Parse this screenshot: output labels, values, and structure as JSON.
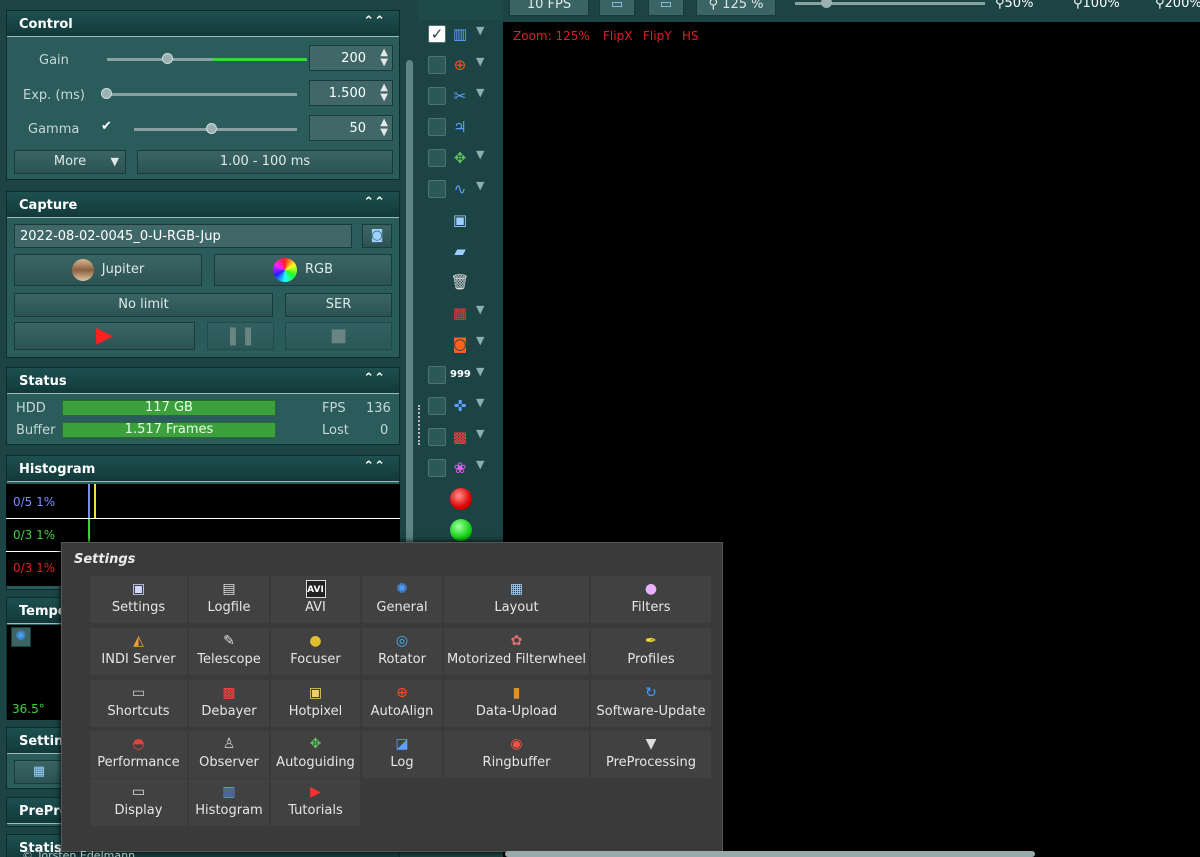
{
  "topbar": {
    "fps_button": "10 FPS",
    "zoom_button": "125 %",
    "zoom_presets": [
      "50%",
      "100%",
      "200%"
    ]
  },
  "control": {
    "title": "Control",
    "gain": {
      "label": "Gain",
      "value": "200",
      "slider_fraction": 0.3
    },
    "exposure": {
      "label": "Exp. (ms)",
      "value": "1.500",
      "slider_fraction": 0.0
    },
    "gamma": {
      "label": "Gamma",
      "value": "50",
      "checked": true,
      "slider_fraction": 0.5
    },
    "more_button": "More",
    "range_button": "1.00 - 100 ms"
  },
  "capture": {
    "title": "Capture",
    "filename": "2022-08-02-0045_0-U-RGB-Jup",
    "object_button": "Jupiter",
    "filter_button": "RGB",
    "limit_button": "No limit",
    "format_button": "SER"
  },
  "status": {
    "title": "Status",
    "hdd_label": "HDD",
    "hdd_value": "117 GB",
    "buffer_label": "Buffer",
    "buffer_value": "1.517 Frames",
    "fps_label": "FPS",
    "fps_value": "136",
    "lost_label": "Lost",
    "lost_value": "0"
  },
  "histogram": {
    "title": "Histogram",
    "rows": [
      {
        "label": "0/5 1%",
        "color": "#7a8cff"
      },
      {
        "label": "0/3 1%",
        "color": "#3cd23c"
      },
      {
        "label": "0/3 1%",
        "color": "#e02020"
      }
    ]
  },
  "hidden_panels": {
    "temperature": "Tempe",
    "temp_value": "36.5°",
    "settings": "Setting",
    "preprocessing": "PrePro",
    "statistics": "Statist"
  },
  "viewer": {
    "zoom_text": "Zoom: 125%",
    "flipx": "FlipX",
    "flipy": "FlipY",
    "hs": "HS"
  },
  "settings_popup": {
    "title": "Settings",
    "items": [
      {
        "label": "Settings",
        "icon": "settings-icon",
        "glyph": "▣",
        "color": "#cfd8ff"
      },
      {
        "label": "Logfile",
        "icon": "logfile-icon",
        "glyph": "▤",
        "color": "#dddddd"
      },
      {
        "label": "AVI",
        "icon": "avi-icon",
        "glyph": "AVI",
        "color": "#ffffff"
      },
      {
        "label": "General",
        "icon": "gear-icon",
        "glyph": "✺",
        "color": "#4a9aff"
      },
      {
        "label": "Layout",
        "icon": "layout-icon",
        "glyph": "▦",
        "color": "#9ad0ff"
      },
      {
        "label": "Filters",
        "icon": "color-wheel-icon",
        "glyph": "●",
        "color": "#e8b0ff"
      },
      {
        "label": "INDI Server",
        "icon": "indi-icon",
        "glyph": "◭",
        "color": "#f0a030"
      },
      {
        "label": "Telescope",
        "icon": "telescope-icon",
        "glyph": "✎",
        "color": "#dddddd"
      },
      {
        "label": "Focuser",
        "icon": "focuser-icon",
        "glyph": "●",
        "color": "#e0c030"
      },
      {
        "label": "Rotator",
        "icon": "rotator-icon",
        "glyph": "◎",
        "color": "#4ab0ff"
      },
      {
        "label": "Motorized Filterwheel",
        "icon": "filterwheel-icon",
        "glyph": "✿",
        "color": "#e07070"
      },
      {
        "label": "Profiles",
        "icon": "profiles-icon",
        "glyph": "✒",
        "color": "#f0e030"
      },
      {
        "label": "Shortcuts",
        "icon": "keyboard-icon",
        "glyph": "▭",
        "color": "#cccccc"
      },
      {
        "label": "Debayer",
        "icon": "debayer-icon",
        "glyph": "▩",
        "color": "#ff4040"
      },
      {
        "label": "Hotpixel",
        "icon": "hotpixel-icon",
        "glyph": "▣",
        "color": "#f0d060"
      },
      {
        "label": "AutoAlign",
        "icon": "crosshair-icon",
        "glyph": "⊕",
        "color": "#ff5020"
      },
      {
        "label": "Data-Upload",
        "icon": "upload-icon",
        "glyph": "▮",
        "color": "#e09030"
      },
      {
        "label": "Software-Update",
        "icon": "update-icon",
        "glyph": "↻",
        "color": "#40a0ff"
      },
      {
        "label": "Performance",
        "icon": "gauge-icon",
        "glyph": "◓",
        "color": "#e04040"
      },
      {
        "label": "Observer",
        "icon": "person-icon",
        "glyph": "♙",
        "color": "#cccccc"
      },
      {
        "label": "Autoguiding",
        "icon": "autoguiding-icon",
        "glyph": "✥",
        "color": "#60c060"
      },
      {
        "label": "Log",
        "icon": "log-icon",
        "glyph": "◪",
        "color": "#60a0ff"
      },
      {
        "label": "Ringbuffer",
        "icon": "ringbuffer-icon",
        "glyph": "◉",
        "color": "#ff5040"
      },
      {
        "label": "PreProcessing",
        "icon": "funnel-icon",
        "glyph": "▼",
        "color": "#dddddd"
      },
      {
        "label": "Display",
        "icon": "display-icon",
        "glyph": "▭",
        "color": "#dddddd"
      },
      {
        "label": "Histogram",
        "icon": "histogram-icon",
        "glyph": "▥",
        "color": "#60a0ff"
      },
      {
        "label": "Tutorials",
        "icon": "tutorials-icon",
        "glyph": "▶",
        "color": "#ff3030"
      }
    ]
  },
  "footer": {
    "copyright": "© Torsten Edelmann"
  }
}
